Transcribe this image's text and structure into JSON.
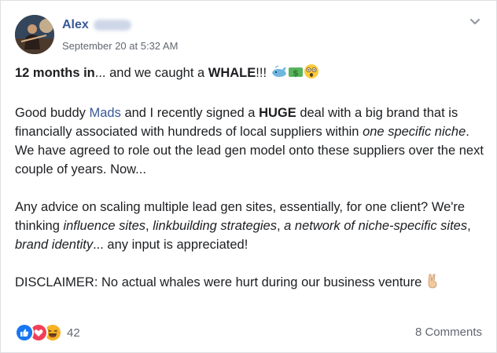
{
  "post": {
    "author_name": "Alex",
    "timestamp": "September 20 at 5:32 AM",
    "menu_icon": "chevron-down-icon",
    "paragraphs": {
      "p1": {
        "bold_start": "12 months in",
        "mid": "... and we caught a ",
        "bold_whale": "WHALE",
        "end": "!!! ",
        "emojis": [
          "whale-emoji",
          "money-emoji",
          "astonished-emoji"
        ]
      },
      "p2": {
        "t1": "Good buddy ",
        "mention": "Mads",
        "t2": " and I recently signed a ",
        "bold": "HUGE",
        "t3": " deal with a big brand that is financially associated with hundreds of local suppliers within ",
        "italic": "one specific niche",
        "t4": ". We have agreed to role out the lead gen model onto these suppliers over the next couple of years. Now..."
      },
      "p3": {
        "t1": "Any advice on scaling multiple lead gen sites, essentially, for one client? We're thinking ",
        "i1": "influence sites",
        "c1": ", ",
        "i2": "linkbuilding strategies",
        "c2": ", ",
        "i3": "a network of niche-specific sites",
        "c3": ", ",
        "i4": "brand identity",
        "t2": "... any input is appreciated!"
      },
      "p4": {
        "text": "DISCLAIMER: No actual whales were hurt during our business venture ",
        "emoji": "victory-hand-emoji"
      }
    }
  },
  "reactions": {
    "icons": [
      "like-icon",
      "love-icon",
      "haha-icon"
    ],
    "count": "42"
  },
  "comments_label": "8 Comments",
  "colors": {
    "link": "#385898",
    "meta": "#616770",
    "like": "#1877f2",
    "love": "#f33e58",
    "haha": "#f7b125"
  }
}
